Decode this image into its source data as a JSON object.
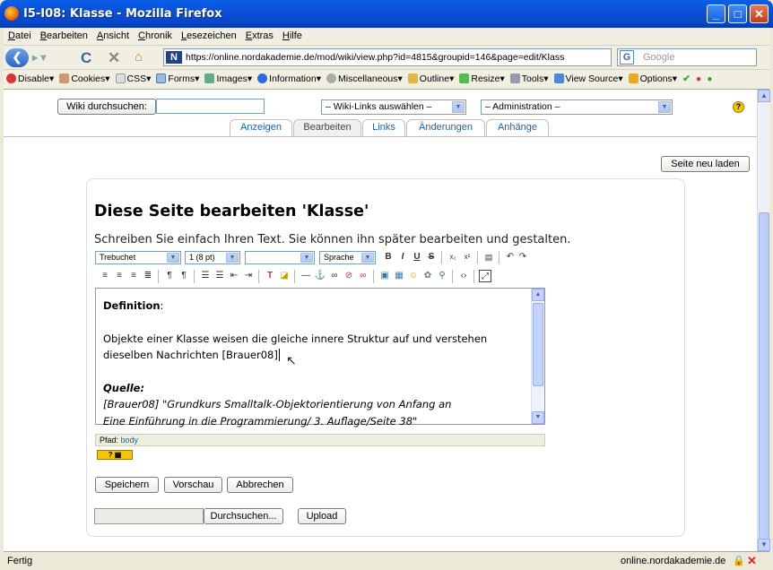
{
  "window": {
    "title": "I5-I08: Klasse - Mozilla Firefox"
  },
  "menu": [
    "Datei",
    "Bearbeiten",
    "Ansicht",
    "Chronik",
    "Lesezeichen",
    "Extras",
    "Hilfe"
  ],
  "nav": {
    "url": "https://online.nordakademie.de/mod/wiki/view.php?id=4815&groupid=146&page=edit/Klass",
    "search_placeholder": "Google"
  },
  "devbar": [
    "Disable",
    "Cookies",
    "CSS",
    "Forms",
    "Images",
    "Information",
    "Miscellaneous",
    "Outline",
    "Resize",
    "Tools",
    "View Source",
    "Options"
  ],
  "wiki": {
    "search_button": "Wiki durchsuchen:",
    "links_select": "– Wiki-Links auswählen –",
    "admin_select": "– Administration –",
    "help_icon_text": "?",
    "tabs": [
      "Anzeigen",
      "Bearbeiten",
      "Links",
      "Änderungen",
      "Anhänge"
    ],
    "reload_button": "Seite neu laden"
  },
  "editor": {
    "title": "Diese Seite bearbeiten 'Klasse'",
    "intro": "Schreiben Sie einfach Ihren Text. Sie können ihn später bearbeiten und gestalten.",
    "font_select": "Trebuchet",
    "size_select": "1 (8 pt)",
    "style_select": "",
    "lang_select": "Sprache",
    "content": {
      "heading": "Definition",
      "heading_colon": ":",
      "para1": "Objekte einer Klasse weisen die gleiche innere Struktur auf und verstehen",
      "para2": "dieselben Nachrichten [Brauer08]",
      "source_label": "Quelle:",
      "source1": "[Brauer08] \"Grundkurs Smalltalk-Objektorientierung von Anfang an",
      "source2": "Eine Einführung in die Programmierung/ 3. Auflage/Seite 38\""
    },
    "path_label": "Pfad:",
    "path_value": "body",
    "buttons": {
      "save": "Speichern",
      "preview": "Vorschau",
      "cancel": "Abbrechen"
    },
    "upload": {
      "browse": "Durchsuchen...",
      "upload": "Upload"
    }
  },
  "statusbar": {
    "left": "Fertig",
    "domain": "online.nordakademie.de"
  }
}
